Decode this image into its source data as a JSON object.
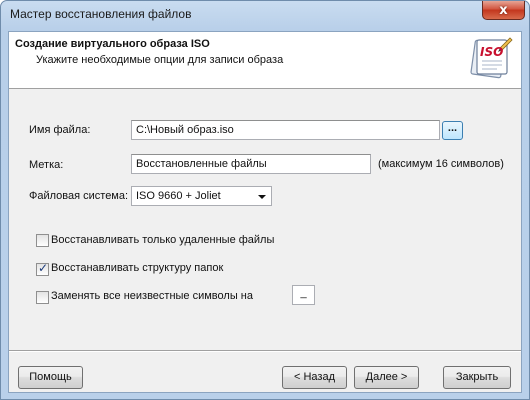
{
  "window": {
    "title": "Мастер восстановления файлов",
    "close_glyph": "x"
  },
  "header": {
    "title": "Создание виртуального образа ISO",
    "subtitle": "Укажите необходимые опции для записи образа",
    "logo_text": "ISO"
  },
  "form": {
    "filename": {
      "label": "Имя файла:",
      "value": "C:\\Новый образ.iso",
      "browse_label": "..."
    },
    "volume_label": {
      "label": "Метка:",
      "value": "Восстановленные файлы",
      "hint": "(максимум 16 символов)"
    },
    "filesystem": {
      "label": "Файловая система:",
      "selected": "ISO 9660 + Joliet"
    },
    "options": [
      {
        "label": "Восстанавливать только удаленные файлы",
        "checked": false
      },
      {
        "label": "Восстанавливать структуру папок",
        "checked": true
      },
      {
        "label": "Заменять все неизвестные символы на",
        "checked": false
      }
    ],
    "replace_char": "_"
  },
  "buttons": {
    "help": "Помощь",
    "back": "< Назад",
    "next": "Далее >",
    "close": "Закрыть"
  },
  "colors": {
    "client_bg": "#f0f0f0",
    "titlebar": "#b9d0ea",
    "close_button": "#c3361d",
    "logo_red": "#c8102e"
  }
}
